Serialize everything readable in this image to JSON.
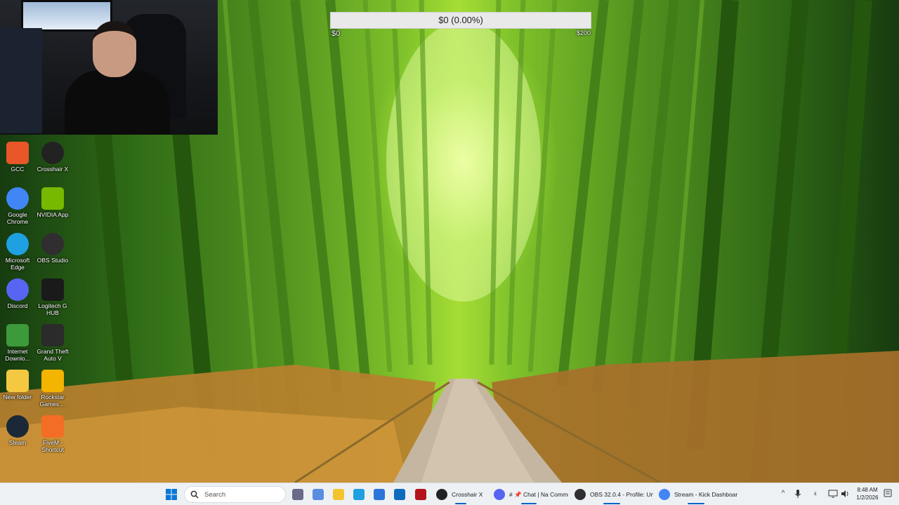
{
  "donation_goal": {
    "text": "$0 (0.00%)",
    "min_label": "$0",
    "max_label": "$200",
    "progress_fraction": 0.0
  },
  "desktop_icons": [
    {
      "name": "gcc-icon",
      "label": "GCC",
      "color": "#e8562a"
    },
    {
      "name": "crosshair-x-icon",
      "label": "Crosshair X",
      "color": "#222222"
    },
    {
      "name": "google-chrome-icon",
      "label": "Google Chrome",
      "color": "#4285f4"
    },
    {
      "name": "nvidia-app-icon",
      "label": "NVIDIA App",
      "color": "#76b900"
    },
    {
      "name": "microsoft-edge-icon",
      "label": "Microsoft Edge",
      "color": "#1fa0e0"
    },
    {
      "name": "obs-studio-icon",
      "label": "OBS Studio",
      "color": "#302e31"
    },
    {
      "name": "discord-icon",
      "label": "Discord",
      "color": "#5865f2"
    },
    {
      "name": "logitech-g-hub-icon",
      "label": "Logitech G HUB",
      "color": "#1a1a1a"
    },
    {
      "name": "internet-download-manager-icon",
      "label": "Internet Downlo...",
      "color": "#3c9a3a"
    },
    {
      "name": "grand-theft-auto-v-icon",
      "label": "Grand Theft Auto V",
      "color": "#2b2b2b"
    },
    {
      "name": "folder-icon",
      "label": "New folder",
      "color": "#f5c842"
    },
    {
      "name": "rockstar-games-icon",
      "label": "Rockstar Games ...",
      "color": "#f4b400"
    },
    {
      "name": "steam-icon",
      "label": "Steam",
      "color": "#1b2838"
    },
    {
      "name": "fivem-icon",
      "label": "FiveM - Shortcut",
      "color": "#f36d24"
    }
  ],
  "taskbar": {
    "search_placeholder": "Search",
    "pinned": [
      {
        "name": "cpu-app-icon",
        "color": "#6a6a8a"
      },
      {
        "name": "multicolor-app-icon",
        "color": "#5a8de0"
      },
      {
        "name": "file-explorer-icon",
        "color": "#f4c430"
      },
      {
        "name": "edge-taskbar-icon",
        "color": "#1fa0e0"
      },
      {
        "name": "store-icon",
        "color": "#2d74d8"
      },
      {
        "name": "outlook-icon",
        "color": "#0f6cbd"
      },
      {
        "name": "red-app-icon",
        "color": "#b3141c"
      }
    ],
    "apps": [
      {
        "name": "taskbar-crosshair-x",
        "label": "Crosshair X",
        "color": "#222222"
      },
      {
        "name": "taskbar-kick-chat",
        "label": "# 📌 Chat | Na Commu",
        "color": "#5865f2"
      },
      {
        "name": "taskbar-obs",
        "label": "OBS 32.0.4 - Profile: Unt",
        "color": "#302e31"
      },
      {
        "name": "taskbar-chrome",
        "label": "Stream - Kick Dashboar",
        "color": "#4285f4"
      }
    ],
    "clock": {
      "time": "8:48 AM",
      "date": "1/2/2026"
    }
  },
  "colors": {
    "taskbar_bg": "#eef1f4",
    "goal_fill": "#7ad14a",
    "accent": "#0a64c8"
  }
}
